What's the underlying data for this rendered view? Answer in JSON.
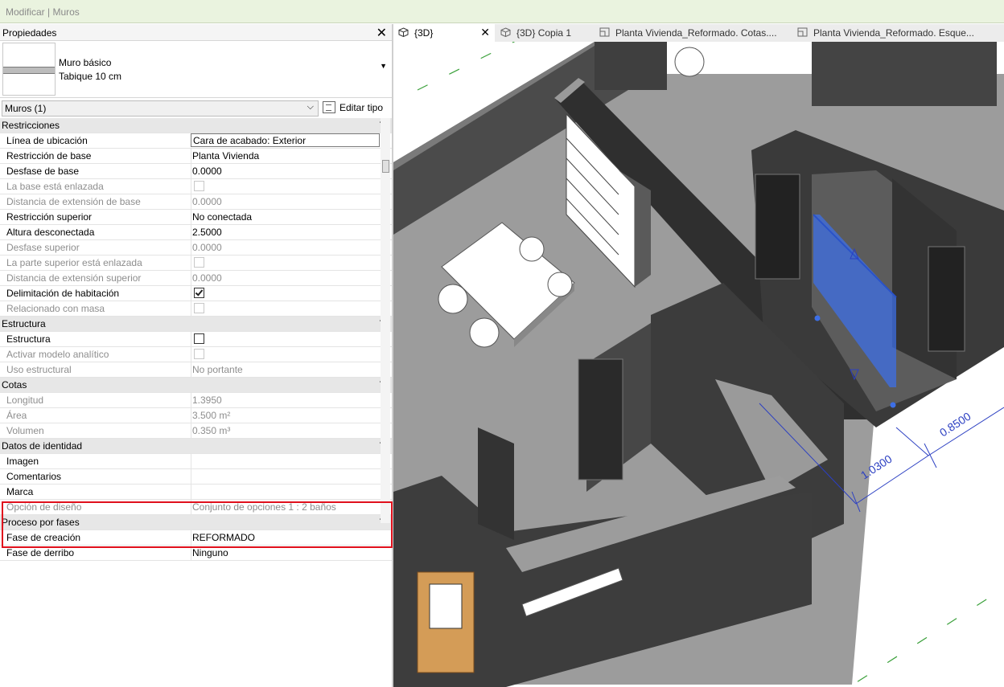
{
  "window": {
    "ribbon_context": "Modificar | Muros"
  },
  "properties": {
    "title": "Propiedades",
    "type_selector": {
      "family": "Muro básico",
      "type": "Tabique 10 cm"
    },
    "instance_filter": "Muros (1)",
    "edit_type_label": "Editar tipo",
    "groups": {
      "constraints": "Restricciones",
      "structure": "Estructura",
      "dimensions": "Cotas",
      "identity": "Datos de identidad",
      "phasing": "Proceso por fases"
    },
    "rows": {
      "location_line": {
        "label": "Línea de ubicación",
        "value": "Cara de acabado: Exterior"
      },
      "base_constraint": {
        "label": "Restricción de base",
        "value": "Planta Vivienda"
      },
      "base_offset": {
        "label": "Desfase de base",
        "value": "0.0000"
      },
      "base_attached": {
        "label": "La base está enlazada"
      },
      "base_extension": {
        "label": "Distancia de extensión de base",
        "value": "0.0000"
      },
      "top_constraint": {
        "label": "Restricción superior",
        "value": "No conectada"
      },
      "unconnected_height": {
        "label": "Altura desconectada",
        "value": "2.5000"
      },
      "top_offset": {
        "label": "Desfase superior",
        "value": "0.0000"
      },
      "top_attached": {
        "label": "La parte superior está enlazada"
      },
      "top_extension": {
        "label": "Distancia de extensión superior",
        "value": "0.0000"
      },
      "room_bounding": {
        "label": "Delimitación de habitación",
        "checked": true
      },
      "related_mass": {
        "label": "Relacionado con masa"
      },
      "structural": {
        "label": "Estructura"
      },
      "analytical": {
        "label": "Activar modelo analítico"
      },
      "structural_usage": {
        "label": "Uso estructural",
        "value": "No portante"
      },
      "length": {
        "label": "Longitud",
        "value": "1.3950"
      },
      "area": {
        "label": "Área",
        "value": "3.500 m²"
      },
      "volume": {
        "label": "Volumen",
        "value": "0.350 m³"
      },
      "image": {
        "label": "Imagen",
        "value": ""
      },
      "comments": {
        "label": "Comentarios",
        "value": ""
      },
      "mark": {
        "label": "Marca",
        "value": ""
      },
      "design_option": {
        "label": "Opción de diseño",
        "value": "Conjunto de opciones 1 : 2 baños"
      },
      "phase_created": {
        "label": "Fase de creación",
        "value": "REFORMADO"
      },
      "phase_demolished": {
        "label": "Fase de derribo",
        "value": "Ninguno"
      }
    }
  },
  "view_tabs": [
    {
      "label": "{3D}",
      "active": true
    },
    {
      "label": "{3D} Copia 1",
      "active": false
    },
    {
      "label": "Planta Vivienda_Reformado. Cotas....",
      "active": false
    },
    {
      "label": "Planta Vivienda_Reformado. Esque...",
      "active": false
    }
  ],
  "viewport": {
    "dimension_1": "1.0300",
    "dimension_2": "0.8500",
    "colors": {
      "wall": "#4a4a4a",
      "floor": "#9a9a9a",
      "selection": "#3d6fe6",
      "dimension": "#2b3fc2",
      "green_line": "#3aa03a"
    }
  }
}
